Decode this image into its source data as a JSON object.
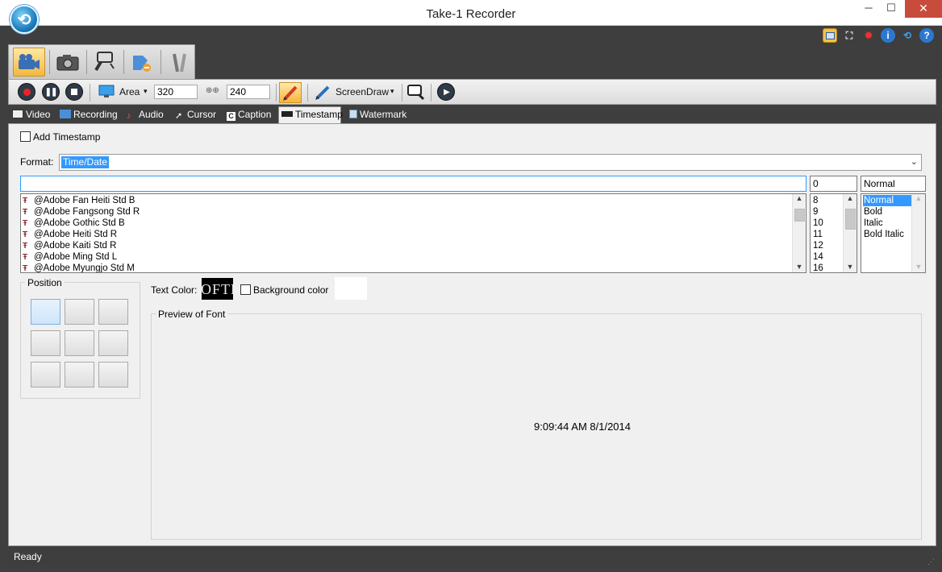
{
  "window": {
    "title": "Take-1 Recorder",
    "minimize": "─",
    "maximize": "☐",
    "close": "✕"
  },
  "modes": [
    {
      "name": "video-mode",
      "icon": "video-camera-icon",
      "selected": true
    },
    {
      "name": "photo-mode",
      "icon": "photo-camera-icon",
      "selected": false
    },
    {
      "name": "zoom-mode",
      "icon": "magnifier-icon",
      "selected": false
    },
    {
      "name": "export-mode",
      "icon": "export-icon",
      "selected": false
    },
    {
      "name": "tools-mode",
      "icon": "tools-icon",
      "selected": false
    }
  ],
  "toolbar": {
    "area_label": "Area",
    "width_value": "320",
    "height_value": "240",
    "screendraw_label": "ScreenDraw"
  },
  "tabs": [
    {
      "label": "Video",
      "active": false
    },
    {
      "label": "Recording",
      "active": false
    },
    {
      "label": "Audio",
      "active": false
    },
    {
      "label": "Cursor",
      "active": false
    },
    {
      "label": "Caption",
      "active": false
    },
    {
      "label": "Timestamp",
      "active": true
    },
    {
      "label": "Watermark",
      "active": false
    }
  ],
  "timestamp": {
    "add_label": "Add Timestamp",
    "format_label": "Format:",
    "format_value": "Time/Date",
    "font_name_value": "",
    "font_size_value": "0",
    "font_style_value": "Normal",
    "fonts": [
      "@Adobe Fan Heiti Std B",
      "@Adobe Fangsong Std R",
      "@Adobe Gothic Std B",
      "@Adobe Heiti Std R",
      "@Adobe Kaiti Std R",
      "@Adobe Ming Std L",
      "@Adobe Myungjo Std M"
    ],
    "sizes": [
      "8",
      "9",
      "10",
      "11",
      "12",
      "14",
      "16"
    ],
    "styles": [
      "Normal",
      "Bold",
      "Italic",
      "Bold Italic"
    ],
    "position_label": "Position",
    "text_color_label": "Text Color:",
    "background_color_label": "Background color",
    "preview_label": "Preview of Font",
    "preview_text": "9:09:44 AM 8/1/2014",
    "text_color": "#000000",
    "background_color": "#ffffff"
  },
  "watermark_text": "SOFTPEDIA",
  "status": {
    "text": "Ready"
  }
}
